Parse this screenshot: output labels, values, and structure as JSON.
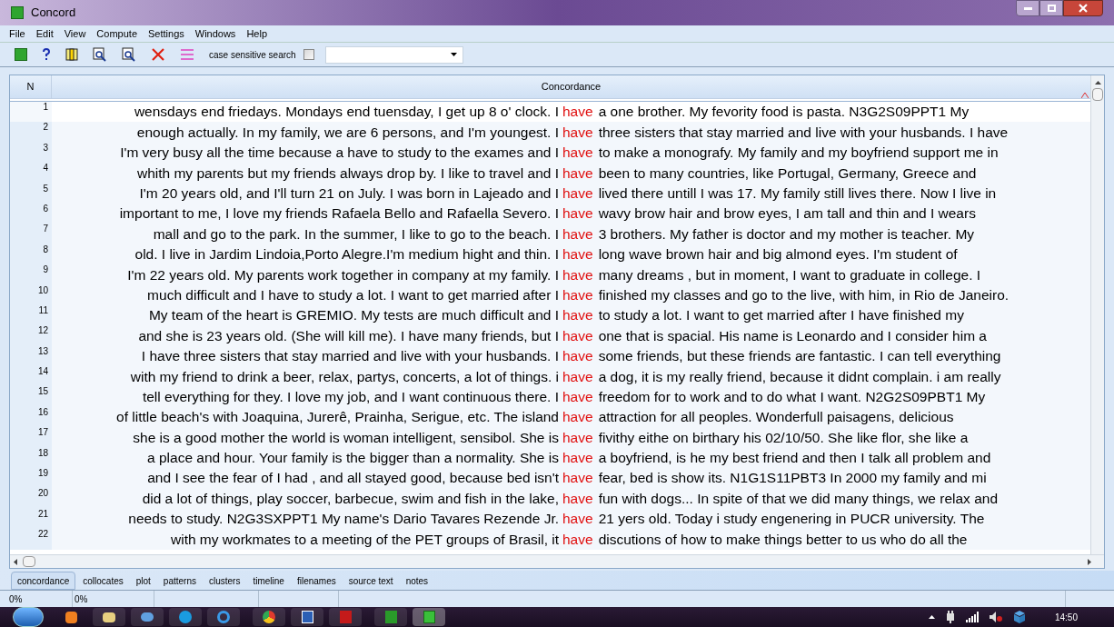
{
  "window": {
    "title": "Concord"
  },
  "menu": [
    "File",
    "Edit",
    "View",
    "Compute",
    "Settings",
    "Windows",
    "Help"
  ],
  "toolbar": {
    "checkbox_label": "case sensitive search",
    "case_sensitive": false
  },
  "table": {
    "columns": [
      "N",
      "Concordance"
    ],
    "rows": [
      {
        "n": "1",
        "left": "wensdays end friedays. Mondays end tuensday, I get up 8 o' clock. I",
        "node": "have",
        "right": "a one brother. My fevority food is pasta. N3G2S09PPT1 My",
        "selected": true
      },
      {
        "n": "2",
        "left": "enough actually. In my family, we are 6 persons, and I'm youngest. I",
        "node": "have",
        "right": "three sisters that stay married and live with your husbands. I have",
        "selected": false
      },
      {
        "n": "3",
        "left": "I'm very busy all the time because a have to study to the exames and I",
        "node": "have",
        "right": "to make a monografy. My family and my boyfriend support me in",
        "selected": false
      },
      {
        "n": "4",
        "left": "whith my parents but my friends always drop by. I like to travel and I",
        "node": "have",
        "right": "been to many countries, like Portugal, Germany, Greece and",
        "selected": false
      },
      {
        "n": "5",
        "left": "I'm 20 years old, and I'll turn 21 on July. I was born in Lajeado and I",
        "node": "have",
        "right": "lived there untill I was 17. My family still lives there. Now I live in",
        "selected": false
      },
      {
        "n": "6",
        "left": "important to me, I love my friends Rafaela Bello and Rafaella Severo. I",
        "node": "have",
        "right": "wavy brow hair and brow eyes, I am tall and thin and I wears",
        "selected": false
      },
      {
        "n": "7",
        "left": "mall and go to the park. In the summer, I like to go to the beach. I",
        "node": "have",
        "right": "3 brothers. My father is doctor and my mother is teacher. My",
        "selected": false
      },
      {
        "n": "8",
        "left": "old. I live in Jardim Lindoia,Porto Alegre.I'm medium hight and thin. I",
        "node": "have",
        "right": "long wave brown hair and big almond eyes. I'm student of",
        "selected": false
      },
      {
        "n": "9",
        "left": "I'm 22 years old. My parents work together in company at my family. I",
        "node": "have",
        "right": "many dreams , but in moment, I want to graduate in college. I",
        "selected": false
      },
      {
        "n": "10",
        "left": "much difficult and I have to study a lot. I want to get married after I",
        "node": "have",
        "right": "finished my classes and go to the live, with him, in Rio de Janeiro.",
        "selected": false
      },
      {
        "n": "11",
        "left": "My team of the heart is GREMIO. My tests are much difficult and I",
        "node": "have",
        "right": "to study a lot. I want to get married after I have finished my",
        "selected": false
      },
      {
        "n": "12",
        "left": "and she is 23 years old. (She will kill me). I have many friends, but I",
        "node": "have",
        "right": "one that is spacial. His name is Leonardo and I consider him a",
        "selected": false
      },
      {
        "n": "13",
        "left": "I have three sisters that stay married and live with your husbands. I",
        "node": "have",
        "right": "some friends, but these friends are fantastic. I can tell everything",
        "selected": false
      },
      {
        "n": "14",
        "left": "with my friend to drink a beer, relax, partys, concerts, a lot of things. i",
        "node": "have",
        "right": "a dog, it is my really friend, because it didnt complain. i am really",
        "selected": false
      },
      {
        "n": "15",
        "left": "tell everything for they. I love my job, and I want continuous there. I",
        "node": "have",
        "right": "freedom for to work and to do what I want. N2G2S09PBT1 My",
        "selected": false
      },
      {
        "n": "16",
        "left": "of little beach's with Joaquina, Jurerê, Prainha, Serigue, etc. The island",
        "node": "have",
        "right": "attraction for all peoples. Wonderfull paisagens, delicious",
        "selected": false
      },
      {
        "n": "17",
        "left": "she is a good mother the world is woman intelligent, sensibol. She is",
        "node": "have",
        "right": "fivithy eithe on birthary his 02/10/50. She like flor, she like a",
        "selected": false
      },
      {
        "n": "18",
        "left": "a place and hour. Your family is the bigger than a normality. She is",
        "node": "have",
        "right": "a boyfriend, is he my best friend and then I talk all problem and",
        "selected": false
      },
      {
        "n": "19",
        "left": "and I see the fear of I had , and all stayed good, because bed isn't",
        "node": "have",
        "right": "fear, bed is show its. N1G1S11PBT3 In 2000 my family and mi",
        "selected": false
      },
      {
        "n": "20",
        "left": "did a lot of things, play soccer, barbecue, swim and fish in the lake,",
        "node": "have",
        "right": "fun with dogs... In spite of that we did many things, we relax and",
        "selected": false
      },
      {
        "n": "21",
        "left": "needs to study. N2G3SXPPT1 My name's Dario Tavares Rezende Jr.",
        "node": "have",
        "right": "21 yers old. Today i study engenering in PUCR university. The",
        "selected": false
      },
      {
        "n": "22",
        "left": "with my workmates to a meeting of the PET groups of Brasil, it",
        "node": "have",
        "right": "discutions of how to make things better to us who do all the",
        "selected": false
      }
    ]
  },
  "tabs": [
    {
      "label": "concordance",
      "selected": true
    },
    {
      "label": "collocates",
      "selected": false
    },
    {
      "label": "plot",
      "selected": false
    },
    {
      "label": "patterns",
      "selected": false
    },
    {
      "label": "clusters",
      "selected": false
    },
    {
      "label": "timeline",
      "selected": false
    },
    {
      "label": "filenames",
      "selected": false
    },
    {
      "label": "source text",
      "selected": false
    },
    {
      "label": "notes",
      "selected": false
    }
  ],
  "status_bar": [
    "0%",
    "0%"
  ],
  "clock": "14:50"
}
